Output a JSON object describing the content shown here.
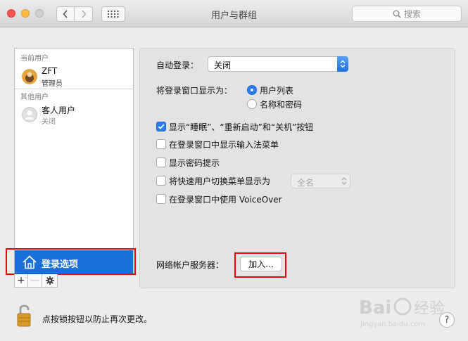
{
  "window": {
    "title": "用户与群组",
    "search_placeholder": "搜索"
  },
  "sidebar": {
    "current_users_label": "当前用户",
    "current_user": {
      "name": "ZFT",
      "role": "管理员"
    },
    "other_users_label": "其他用户",
    "guest_user": {
      "name": "客人用户",
      "status": "关闭"
    },
    "login_options_label": "登录选项",
    "tools": [
      "+",
      "—",
      "gear-icon"
    ]
  },
  "login": {
    "auto_login_label": "自动登录：",
    "auto_login_value": "关闭",
    "display_as_label": "将登录窗口显示为：",
    "display_options": [
      "用户列表",
      "名称和密码"
    ],
    "display_selected": 0,
    "checkboxes": [
      {
        "label": "显示“睡眠”、“重新启动”和“关机”按钮",
        "checked": true
      },
      {
        "label": "在登录窗口中显示输入法菜单",
        "checked": false
      },
      {
        "label": "显示密码提示",
        "checked": false
      },
      {
        "label": "将快速用户切换菜单显示为",
        "checked": false
      },
      {
        "label": "在登录窗口中使用 VoiceOver",
        "checked": false
      }
    ],
    "fast_switch_value": "全名",
    "network_server_label": "网络帐户服务器：",
    "join_button": "加入..."
  },
  "footer": {
    "lock_text": "点按锁按钮以防止再次更改。",
    "help": "?"
  },
  "colors": {
    "accent": "#1a6fd8",
    "highlight_red": "#e8000b",
    "close": "#fc5753",
    "minimize": "#fdbc40"
  }
}
